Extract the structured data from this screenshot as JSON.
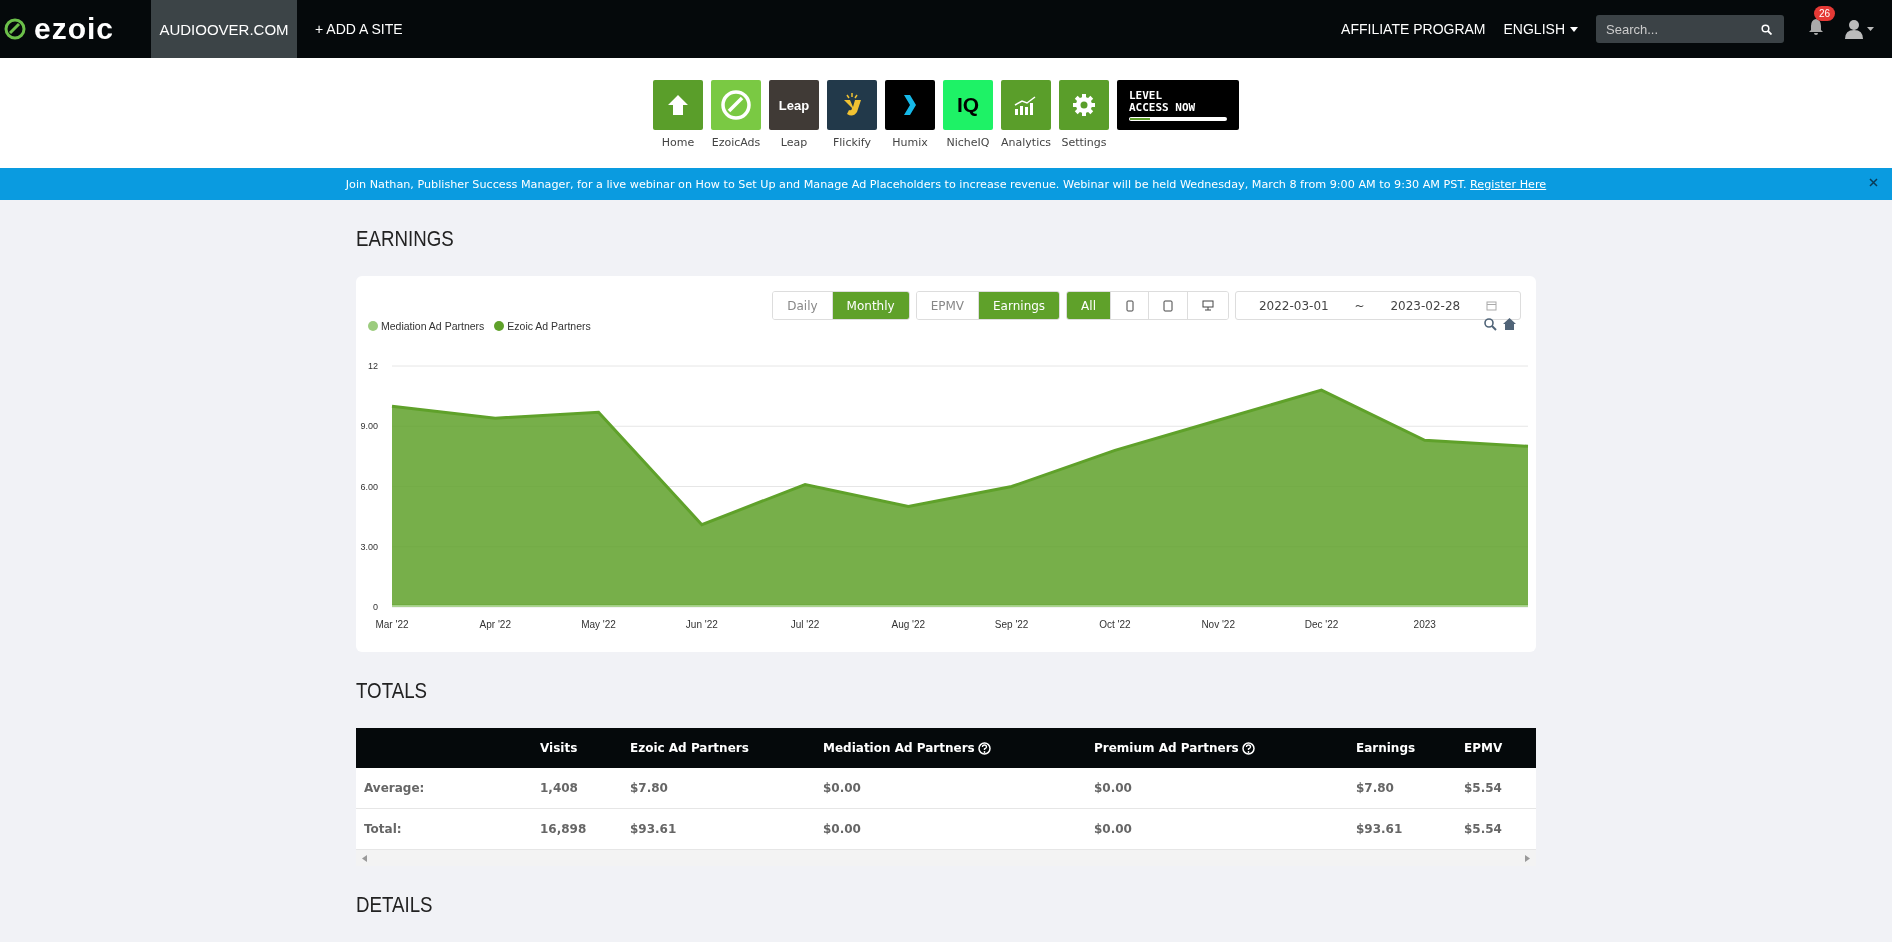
{
  "topbar": {
    "brand": "ezoic",
    "site": "AUDIOOVER.COM",
    "add_site": "+ ADD A SITE",
    "affiliate": "AFFILIATE PROGRAM",
    "language": "ENGLISH",
    "search": {
      "placeholder": "Search..."
    },
    "notifications": "26"
  },
  "apps": [
    {
      "kind": "home",
      "label": "Home"
    },
    {
      "kind": "ezoicads",
      "label": "EzoicAds"
    },
    {
      "kind": "leap",
      "label": "Leap",
      "logo_text": "Leap"
    },
    {
      "kind": "flickify",
      "label": "Flickify"
    },
    {
      "kind": "humix",
      "label": "Humix"
    },
    {
      "kind": "nicheiq",
      "label": "NicheIQ",
      "logo_text": "IQ"
    },
    {
      "kind": "analytics",
      "label": "Analytics"
    },
    {
      "kind": "settings",
      "label": "Settings"
    },
    {
      "kind": "level",
      "logo_lines": [
        "LEVEL",
        "ACCESS NOW"
      ]
    }
  ],
  "banner": {
    "text": "Join Nathan, Publisher Success Manager, for a live webinar on How to Set Up and Manage Ad Placeholders to increase revenue. Webinar will be held Wednesday, March 8 from 9:00 AM to 9:30 AM PST.",
    "link": "Register Here"
  },
  "earnings": {
    "title": "EARNINGS",
    "toggle_groups": [
      [
        {
          "kind": "text",
          "label": "Daily",
          "selected": false
        },
        {
          "kind": "text",
          "label": "Monthly",
          "selected": true
        }
      ],
      [
        {
          "kind": "text",
          "label": "EPMV",
          "selected": false
        },
        {
          "kind": "text",
          "label": "Earnings",
          "selected": true
        }
      ],
      [
        {
          "kind": "text",
          "label": "All",
          "selected": true
        },
        {
          "kind": "phone",
          "selected": false
        },
        {
          "kind": "tablet",
          "selected": false
        },
        {
          "kind": "desktop",
          "selected": false
        }
      ]
    ],
    "date_from": "2022-03-01",
    "date_sep": "~",
    "date_to": "2023-02-28",
    "chart_data": {
      "type": "area",
      "stacked": true,
      "categories": [
        "Mar '22",
        "Apr '22",
        "May '22",
        "Jun '22",
        "Jul '22",
        "Aug '22",
        "Sep '22",
        "Oct '22",
        "Nov '22",
        "Dec '22",
        "2023",
        null
      ],
      "ylim": [
        0,
        12
      ],
      "yticks": [
        {
          "value": 0,
          "label": "0"
        },
        {
          "value": 3,
          "label": "3.00"
        },
        {
          "value": 6,
          "label": "6.00"
        },
        {
          "value": 9,
          "label": "9.00"
        },
        {
          "value": 12,
          "label": "12"
        }
      ],
      "series": [
        {
          "name": "Mediation Ad Partners",
          "color": "#9ccc7e",
          "values": [
            0.1,
            0.1,
            0.1,
            0.1,
            0.1,
            0.1,
            0.1,
            0.1,
            0.1,
            0.1,
            0.1,
            0.1
          ]
        },
        {
          "name": "Ezoic Ad Partners",
          "color": "#5fa12a",
          "values": [
            9.9,
            9.3,
            9.6,
            4.0,
            6.0,
            4.9,
            5.9,
            7.7,
            9.2,
            10.7,
            8.2,
            7.9
          ]
        }
      ]
    }
  },
  "totals": {
    "title": "TOTALS",
    "columns": [
      {
        "label": "Visits",
        "help": false
      },
      {
        "label": "Ezoic Ad Partners",
        "help": false
      },
      {
        "label": "Mediation Ad Partners",
        "help": true
      },
      {
        "label": "Premium Ad Partners",
        "help": true
      },
      {
        "label": "Earnings",
        "help": false
      },
      {
        "label": "EPMV",
        "help": false
      }
    ],
    "rows": [
      {
        "label": "Average:",
        "cells": [
          "1,408",
          "$7.80",
          "$0.00",
          "$0.00",
          "$7.80",
          "$5.54"
        ]
      },
      {
        "label": "Total:",
        "cells": [
          "16,898",
          "$93.61",
          "$0.00",
          "$0.00",
          "$93.61",
          "$5.54"
        ]
      }
    ]
  },
  "details": {
    "title": "DETAILS"
  }
}
